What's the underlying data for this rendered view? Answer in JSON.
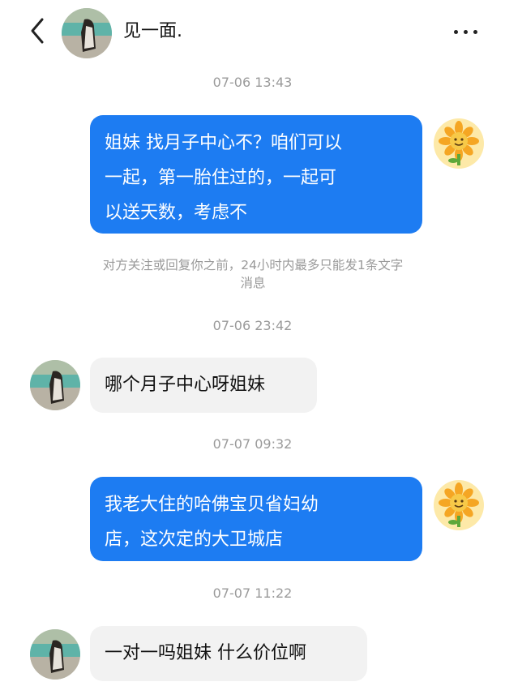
{
  "header": {
    "back_icon": "chevron-left-icon",
    "title": "见一面.",
    "more_icon": "more-horizontal-icon"
  },
  "colors": {
    "outgoing_bubble": "#1d7cf2",
    "incoming_bubble": "#f2f2f2",
    "timestamp_text": "#9a9a9a"
  },
  "messages": [
    {
      "type": "timestamp",
      "text": "07-06 13:43"
    },
    {
      "type": "outgoing",
      "lines": [
        "姐妹 找月子中心不？咱们可以",
        "一起，第一胎住过的，一起可",
        "以送天数，考虑不"
      ]
    },
    {
      "type": "notice",
      "lines": [
        "对方关注或回复你之前，24小时内最多只能发1条文字",
        "消息"
      ]
    },
    {
      "type": "timestamp",
      "text": "07-06 23:42"
    },
    {
      "type": "incoming",
      "lines": [
        "哪个月子中心呀姐妹"
      ]
    },
    {
      "type": "timestamp",
      "text": "07-07 09:32"
    },
    {
      "type": "outgoing",
      "lines": [
        "我老大住的哈佛宝贝省妇幼",
        "店，这次定的大卫城店"
      ]
    },
    {
      "type": "timestamp",
      "text": "07-07 11:22"
    },
    {
      "type": "incoming",
      "lines": [
        "一对一吗姐妹 什么价位啊"
      ]
    }
  ]
}
